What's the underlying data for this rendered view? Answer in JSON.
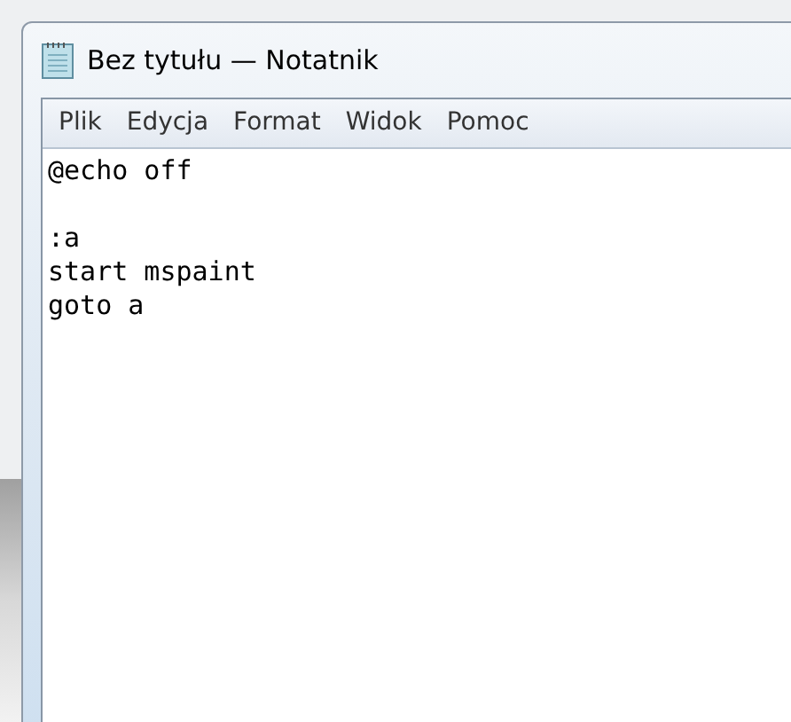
{
  "window": {
    "title": "Bez tytułu — Notatnik"
  },
  "menu": [
    {
      "label": "Plik"
    },
    {
      "label": "Edycja"
    },
    {
      "label": "Format"
    },
    {
      "label": "Widok"
    },
    {
      "label": "Pomoc"
    }
  ],
  "editor": {
    "text": "@echo off\n\n:a\nstart mspaint\ngoto a"
  }
}
